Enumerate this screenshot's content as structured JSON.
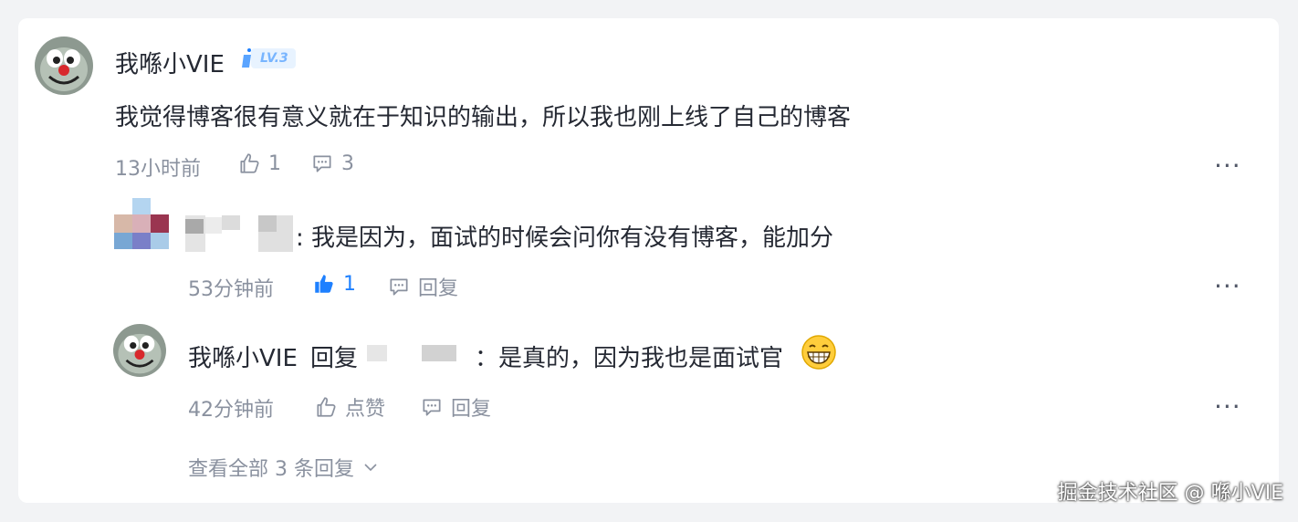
{
  "comment": {
    "author": "我喺小VIE",
    "level_badge": "LV.3",
    "text": "我觉得博客很有意义就在于知识的输出，所以我也刚上线了自己的博客",
    "time": "13小时前",
    "likes": "1",
    "replies": "3"
  },
  "reply1": {
    "text": ": 我是因为，面试的时候会问你有没有博客，能加分",
    "time": "53分钟前",
    "likes": "1",
    "reply_label": "回复"
  },
  "reply2": {
    "author": "我喺小VIE",
    "reply_word": "回复",
    "text": "：是真的，因为我也是面试官",
    "time": "42分钟前",
    "like_label": "点赞",
    "reply_label": "回复"
  },
  "view_more": "查看全部 3 条回复",
  "watermark": "掘金技术社区 @ 喺小VIE",
  "colors": {
    "accent": "#1e80ff",
    "meta": "#8a919f",
    "text": "#252933"
  },
  "icons": [
    "avatar-character",
    "level-icon",
    "thumb-up-icon",
    "comment-icon",
    "more-icon",
    "grin-emoji",
    "chevron-down-icon"
  ]
}
